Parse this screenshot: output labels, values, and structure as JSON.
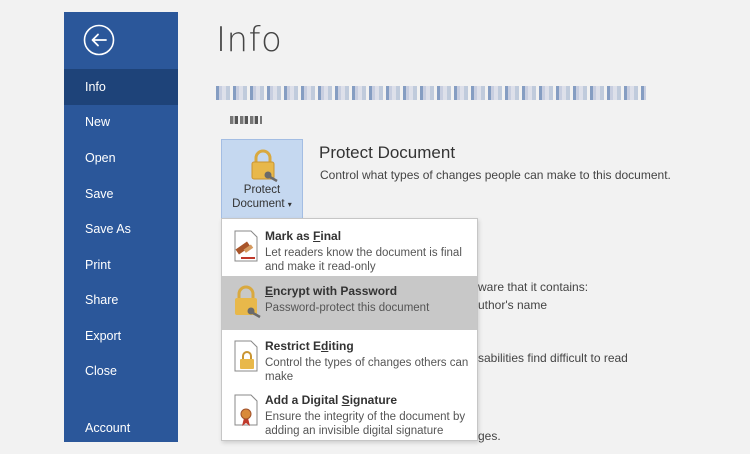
{
  "sidebar": {
    "back_label": "Back",
    "items": [
      {
        "label": "Info",
        "active": true
      },
      {
        "label": "New"
      },
      {
        "label": "Open"
      },
      {
        "label": "Save"
      },
      {
        "label": "Save As"
      },
      {
        "label": "Print"
      },
      {
        "label": "Share"
      },
      {
        "label": "Export"
      },
      {
        "label": "Close"
      },
      {
        "label": "Account"
      }
    ]
  },
  "main": {
    "title": "Info",
    "protect": {
      "button_line1": "Protect",
      "button_line2": "Document",
      "dropdown_arrow": "▾",
      "section_title": "Protect Document",
      "section_desc": "Control what types of changes people can make to this document."
    },
    "background_fragments": {
      "inspect": "ware that it contains:",
      "author": "uthor's name",
      "disabilities": "sabilities find difficult to read",
      "changes": "ges."
    }
  },
  "dropdown_menu": {
    "items": [
      {
        "title": "Mark as Final",
        "title_pre": "Mark as ",
        "title_key": "F",
        "title_post": "inal",
        "desc": "Let readers know the document is final and make it read-only",
        "icon": "mark-final-icon"
      },
      {
        "title": "Encrypt with Password",
        "title_pre": "",
        "title_key": "E",
        "title_post": "ncrypt with Password",
        "desc": "Password-protect this document",
        "icon": "lock-key-icon",
        "highlighted": true
      },
      {
        "title": "Restrict Editing",
        "title_pre": "Restrict E",
        "title_key": "d",
        "title_post": "iting",
        "desc": "Control the types of changes others can make",
        "icon": "lock-document-icon"
      },
      {
        "title": "Add a Digital Signature",
        "title_pre": "Add a Digital ",
        "title_key": "S",
        "title_post": "ignature",
        "desc": "Ensure the integrity of the document by adding an invisible digital signature",
        "icon": "digital-signature-icon"
      }
    ]
  },
  "colors": {
    "sidebar": "#2b579a",
    "sidebar_active": "#1e4379",
    "protect_button": "#c5d8f0",
    "highlight": "#c8c8c8",
    "lock_gold": "#e8b84a"
  }
}
